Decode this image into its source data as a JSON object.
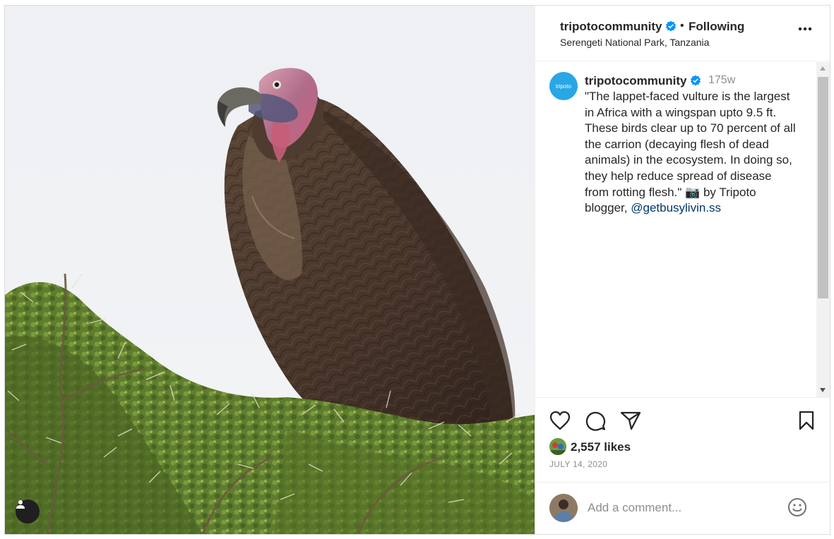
{
  "post": {
    "username": "tripotocommunity",
    "separator": "•",
    "follow_status": "Following",
    "location": "Serengeti National Park, Tanzania"
  },
  "caption": {
    "avatar_label": "tripoto",
    "username": "tripotocommunity",
    "time_ago": "175w",
    "text": "\"The lappet-faced vulture is the largest\nin Africa with a wingspan upto 9.5 ft.\nThese birds clear up to 70 percent of all\nthe carrion (decaying flesh of dead\nanimals) in the ecosystem. In doing so,\nthey help reduce spread of disease\nfrom rotting flesh.\" 📷 by Tripoto\nblogger, ",
    "mention": "@getbusylivin.ss"
  },
  "engagement": {
    "likes": "2,557 likes",
    "date": "JULY 14, 2020"
  },
  "comment": {
    "placeholder": "Add a comment..."
  },
  "icons": {
    "verified": "verified-badge-icon",
    "more": "more-options-icon",
    "like": "heart-icon",
    "comment": "comment-bubble-icon",
    "share": "paper-plane-icon",
    "save": "bookmark-icon",
    "emoji": "smiley-icon",
    "tag": "user-tag-icon"
  },
  "colors": {
    "verified_blue": "#0095f6",
    "mention_link": "#00376b",
    "secondary_text": "#8e8e8e",
    "tripoto_brand": "#28a6e6"
  }
}
